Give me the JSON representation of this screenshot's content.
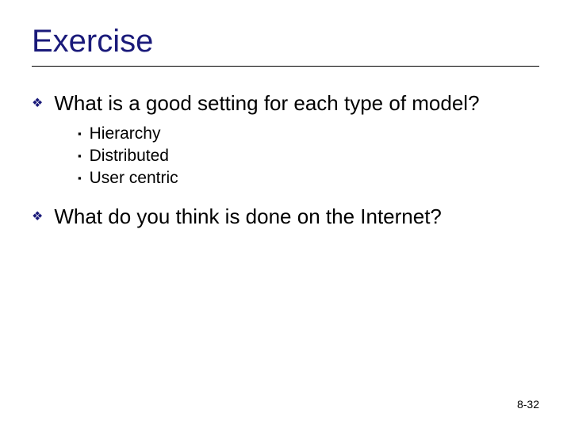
{
  "slide": {
    "title": "Exercise",
    "items": [
      {
        "text": "What is a good setting for each type of model?",
        "sub": [
          "Hierarchy",
          "Distributed",
          "User centric"
        ]
      },
      {
        "text": "What do you think is done on the Internet?",
        "sub": []
      }
    ],
    "page_number": "8-32"
  }
}
